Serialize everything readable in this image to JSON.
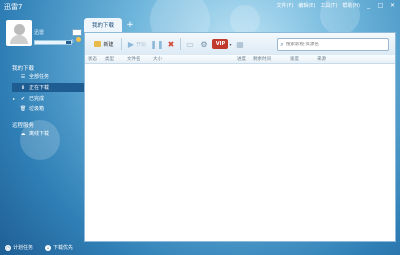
{
  "app": {
    "title": "迅雷7"
  },
  "menubar": {
    "items": [
      "文件(F)",
      "编辑(E)",
      "工具(T)",
      "帮助(H)"
    ],
    "min_label": "_",
    "max_label": "□",
    "close_label": "✕"
  },
  "user": {
    "name": "迅雷",
    "level_value": "0",
    "level_progress": 0.85
  },
  "sidebar": {
    "section_downloads": "我的下载",
    "items": [
      {
        "label": "全部任务",
        "icon": "list-icon"
      },
      {
        "label": "正在下载",
        "icon": "download-arrow-icon",
        "active": true
      },
      {
        "label": "已完成",
        "icon": "check-icon"
      },
      {
        "label": "垃圾箱",
        "icon": "trash-icon"
      }
    ],
    "section_remote": "远程服务",
    "remote_items": [
      {
        "label": "离线下载",
        "icon": "cloud-icon"
      }
    ],
    "bottom": [
      {
        "label": "计划任务",
        "icon": "clock-icon"
      },
      {
        "label": "下载优先",
        "icon": "speed-icon"
      }
    ]
  },
  "tabs": {
    "active": "我的下载",
    "add": "+"
  },
  "toolbar": {
    "new_label": "新建",
    "start_label": "开始",
    "vip_label": "VIP",
    "search_placeholder": "搜索影视·资源名"
  },
  "columns": [
    "状态",
    "类型",
    "文件名",
    "大小",
    "进度",
    "剩余时间",
    "速度",
    "来源"
  ]
}
